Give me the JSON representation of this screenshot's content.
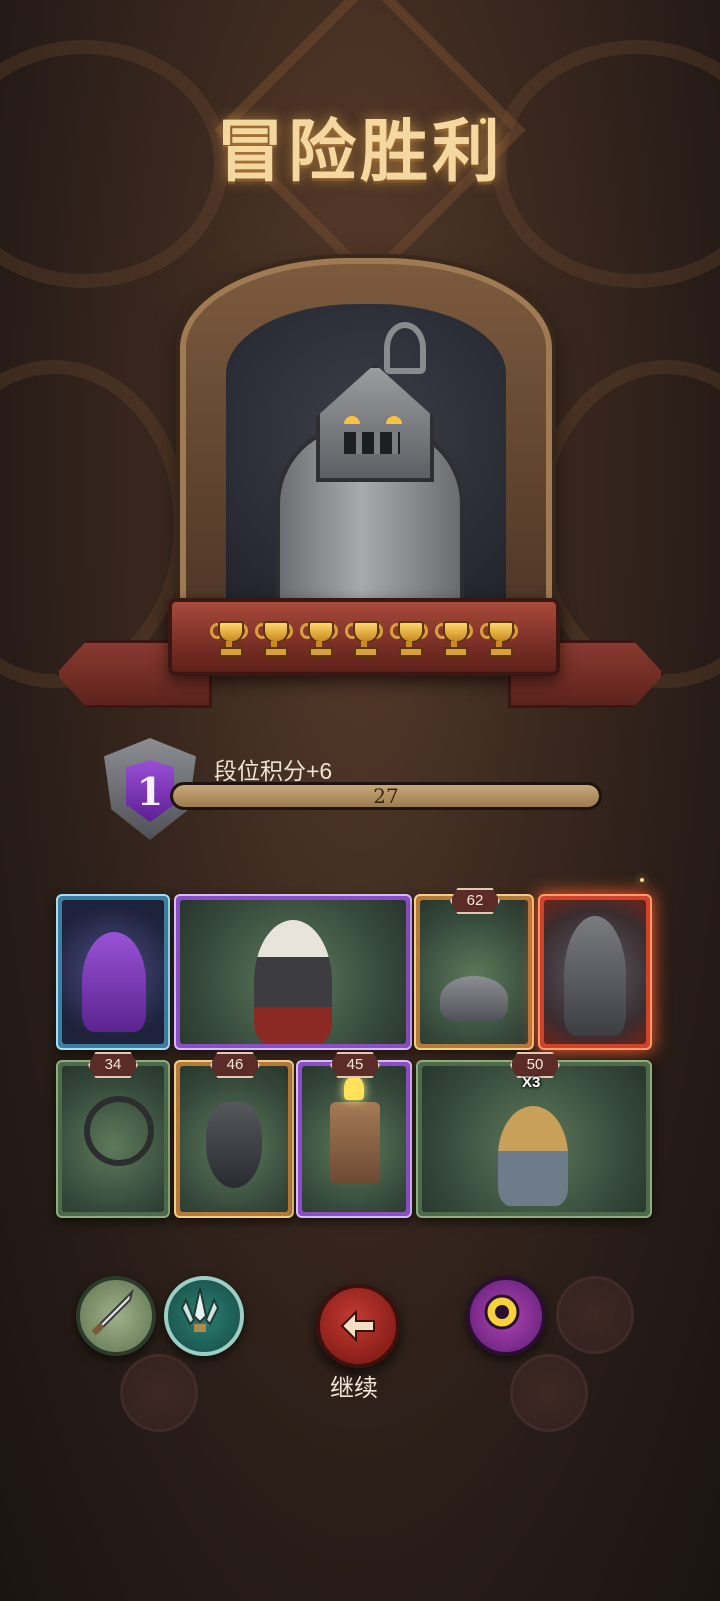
{
  "title": "冒险胜利",
  "hero": {
    "trophies": 7
  },
  "rank": {
    "tier": "1",
    "points_label": "段位积分+6",
    "value": "27",
    "progress": 1.0
  },
  "cards_row1": [
    {
      "name": "purple-dragon",
      "frame": "blue"
    },
    {
      "name": "masked-warrior",
      "frame": "purple"
    },
    {
      "name": "mechanical-mouse",
      "frame": "gold",
      "cost": "62"
    },
    {
      "name": "armored-knight",
      "frame": "fire"
    }
  ],
  "cards_row2": [
    {
      "name": "spring-trap",
      "frame": "green",
      "cost": "34"
    },
    {
      "name": "mechanical-bird",
      "frame": "gold",
      "cost": "46"
    },
    {
      "name": "lamp-robot",
      "frame": "purple",
      "cost": "45"
    },
    {
      "name": "goblin-robots",
      "frame": "green",
      "cost": "50",
      "multiplier": "X3"
    }
  ],
  "buttons": {
    "continue_label": "继续"
  },
  "colors": {
    "title": "#f5d7a0",
    "ribbon": "#7a2f26",
    "rank_badge": "#5d1f94",
    "continue_button": "#c43a31"
  }
}
